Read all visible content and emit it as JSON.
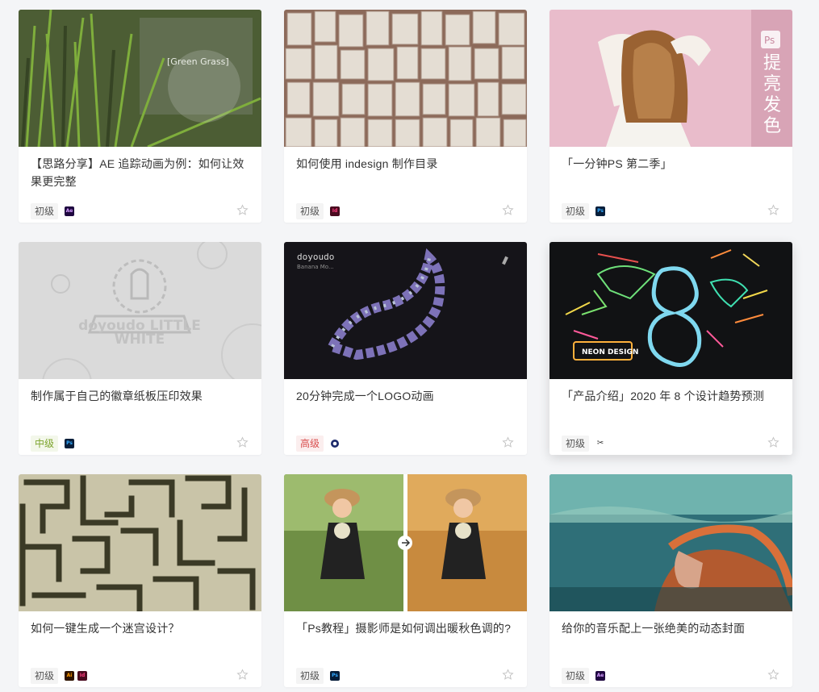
{
  "cards": [
    {
      "title": "【思路分享】AE 追踪动画为例：如何让效果更完整",
      "level": "初级",
      "software": [
        "ae"
      ],
      "thumb_text": "[Green Grass]"
    },
    {
      "title": "如何使用 indesign 制作目录",
      "level": "初级",
      "software": [
        "id"
      ]
    },
    {
      "title": "「一分钟PS 第二季」",
      "level": "初级",
      "software": [
        "ps"
      ],
      "thumb_text": "提亮发色",
      "thumb_badge": "Ps"
    },
    {
      "title": "制作属于自己的徽章纸板压印效果",
      "level": "中级",
      "software": [
        "ps"
      ],
      "thumb_text": "doyoudo LITTLE WHITE"
    },
    {
      "title": "20分钟完成一个LOGO动画",
      "level": "高级",
      "software": [
        "c4d"
      ],
      "thumb_text": "doyoudo",
      "thumb_sub": "Banana Mo..."
    },
    {
      "title": "「产品介绍」2020 年 8 个设计趋势预测",
      "level": "初级",
      "software": [
        "tool"
      ],
      "thumb_text": "NEON DESIGN"
    },
    {
      "title": "如何一键生成一个迷宫设计？",
      "level": "初级",
      "software": [
        "ai",
        "id"
      ]
    },
    {
      "title": "「Ps教程」摄影师是如何调出暖秋色调的?",
      "level": "初级",
      "software": [
        "ps"
      ]
    },
    {
      "title": "给你的音乐配上一张绝美的动态封面",
      "level": "初级",
      "software": [
        "ae"
      ]
    }
  ],
  "software_labels": {
    "ae": "Ae",
    "id": "Id",
    "ps": "Ps",
    "ai": "Ai",
    "c4d": "",
    "tool": "✂"
  },
  "colors": {
    "beginner_bg": "#f4f4f4",
    "intermediate": "#7da42e",
    "advanced": "#d94f4f",
    "star": "#c4c4c4"
  }
}
